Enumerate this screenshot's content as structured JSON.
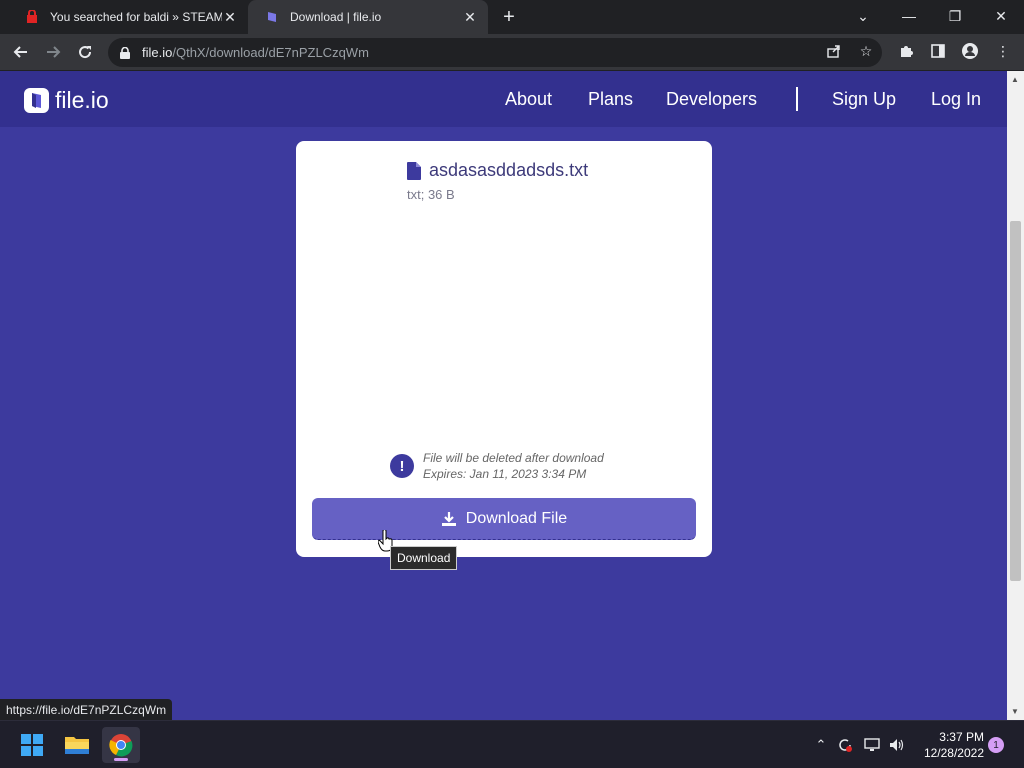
{
  "browser": {
    "tabs": [
      {
        "title": "You searched for baldi » STEAMU",
        "active": false
      },
      {
        "title": "Download | file.io",
        "active": true
      }
    ],
    "url_host": "file.io",
    "url_path": "/QthX/download/dE7nPZLCzqWm"
  },
  "site": {
    "logo_text": "file.io",
    "nav": {
      "about": "About",
      "plans": "Plans",
      "developers": "Developers",
      "signup": "Sign Up",
      "login": "Log In"
    }
  },
  "file": {
    "name": "asdasasddadsds.txt",
    "meta": "txt; 36 B",
    "notice_line1": "File will be deleted after download",
    "notice_line2": "Expires: Jan 11, 2023 3:34 PM",
    "download_label": "Download File",
    "tooltip": "Download"
  },
  "status_bar_url": "https://file.io/dE7nPZLCzqWm",
  "taskbar": {
    "time": "3:37 PM",
    "date": "12/28/2022",
    "notifications": "1"
  },
  "colors": {
    "page_bg": "#3d3a9e",
    "header_bg": "#33308f",
    "button_bg": "#6661c4"
  }
}
